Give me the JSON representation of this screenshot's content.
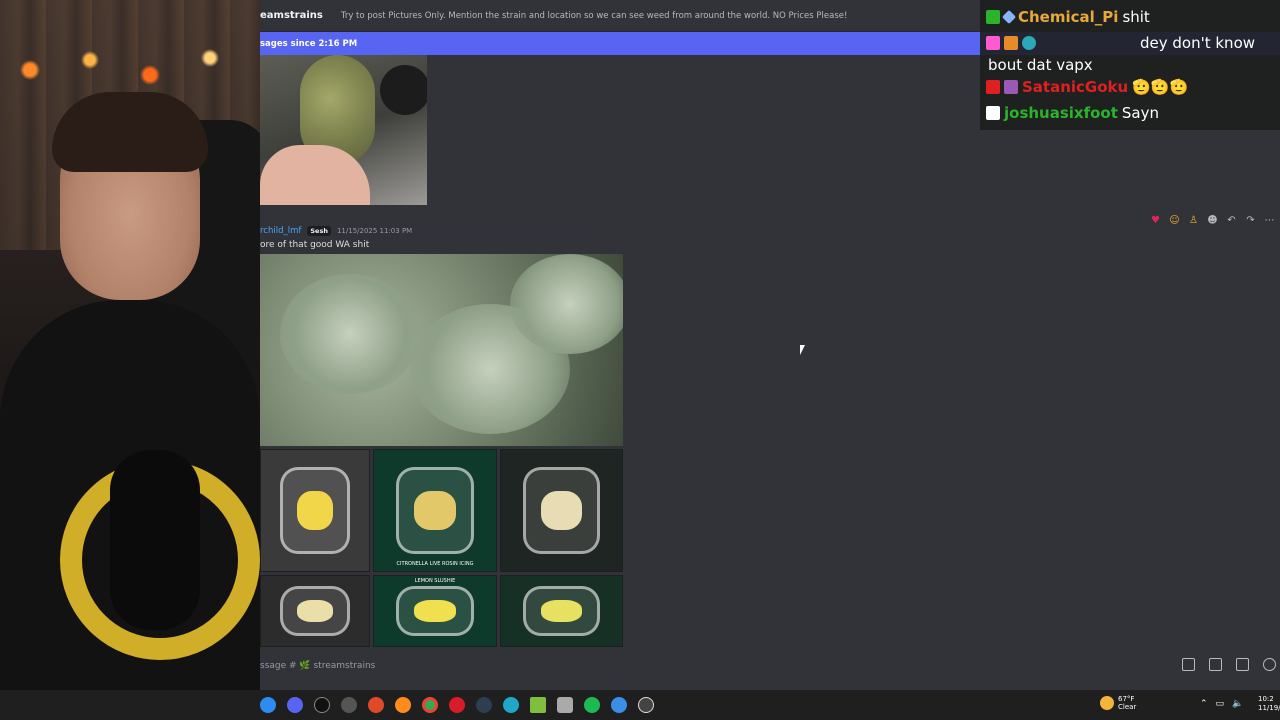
{
  "discord": {
    "channel": "eamstrains",
    "topic": "Try to post Pictures Only. Mention the strain and location so we can see weed from around the world. NO Prices Please!",
    "new_messages_banner": "sages since 2:16 PM",
    "message": {
      "author": "rchild_lmf",
      "tag": "Sesh",
      "timestamp": "11/15/2025 11:03 PM",
      "text": "ore of that good WA shit"
    },
    "image_labels": [
      "CITRONELLA LIVE ROSIN ICING",
      "LEMON SLUSHIE"
    ],
    "input_placeholder": "ssage # 🌿 streamstrains",
    "accent_color": "#5865f2"
  },
  "chat": {
    "lines": [
      {
        "user": "Chemical_Pi",
        "message": "shit",
        "user_color": "#e6a93a"
      },
      {
        "user": "",
        "message": "dey don't know",
        "user_color": "#7b3fe4"
      },
      {
        "user": "",
        "message": "bout dat vapx",
        "user_color": "#ffffff"
      },
      {
        "user": "SatanicGoku",
        "message": "🫡🫡🫡",
        "user_color": "#e02020"
      },
      {
        "user": "joshuasixfoot",
        "message": "Sayn",
        "user_color": "#2bb32b"
      }
    ]
  },
  "taskbar": {
    "weather_temp": "67°F",
    "weather_desc": "Clear",
    "clock_time": "10:2",
    "clock_date": "11/19/"
  }
}
